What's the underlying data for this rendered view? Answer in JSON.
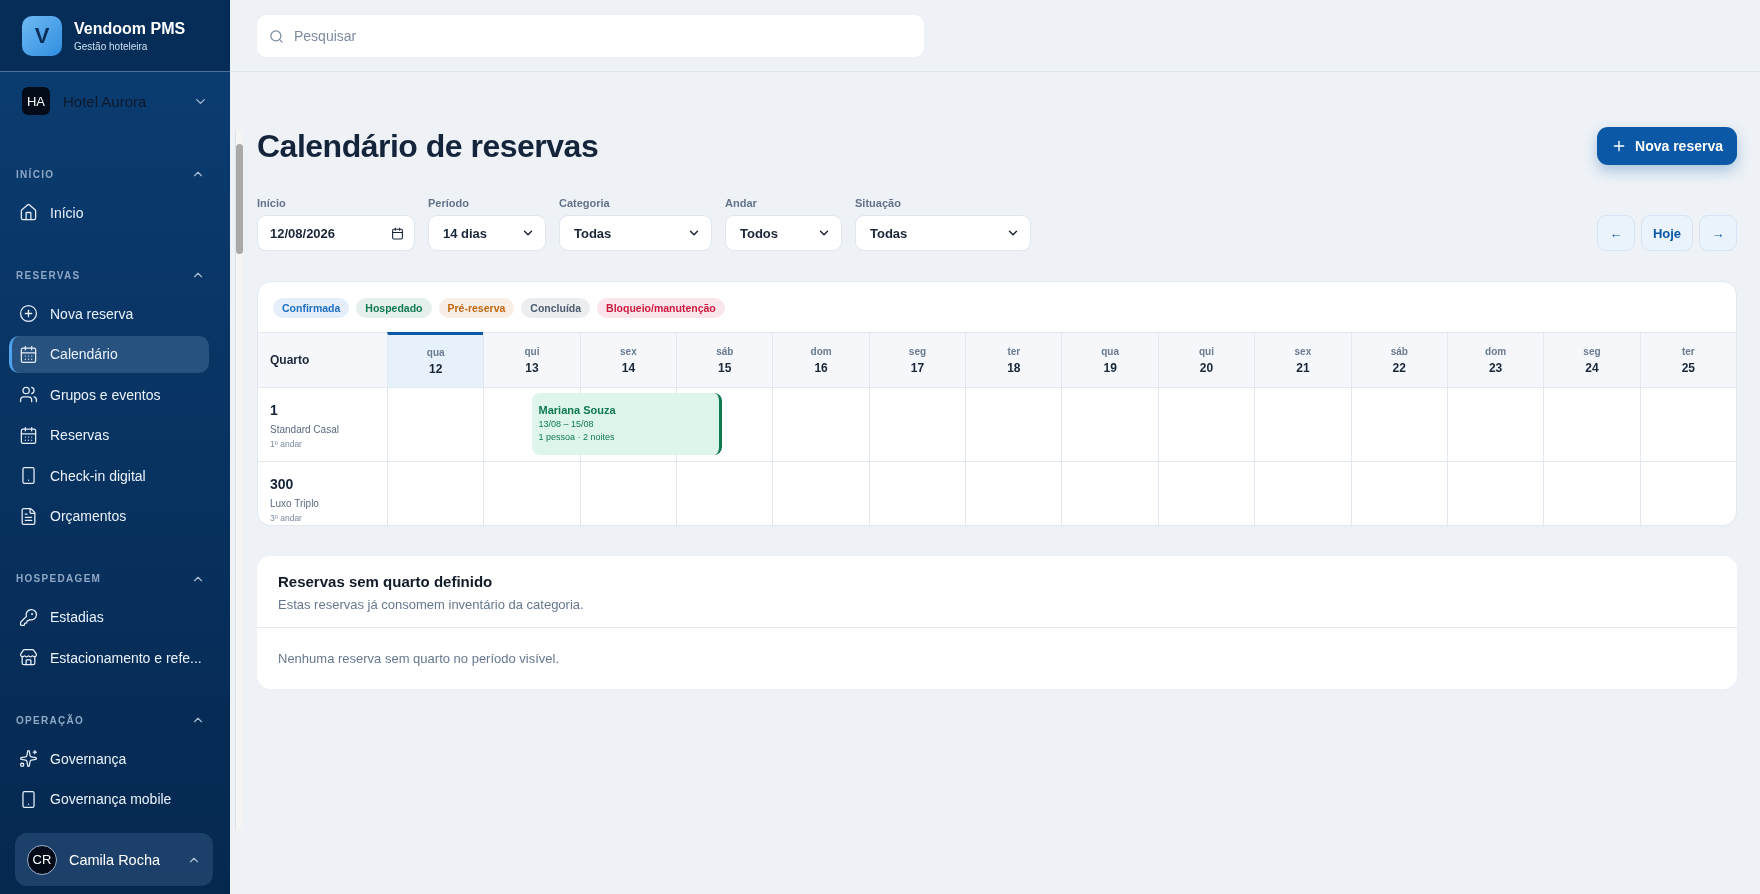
{
  "brand": {
    "logo_letter": "V",
    "name": "Vendoom PMS",
    "subtitle": "Gestão hoteleira"
  },
  "hotel": {
    "initials": "HA",
    "name": "Hotel Aurora"
  },
  "sidebar": {
    "sections": [
      {
        "title": "INÍCIO",
        "expanded": true,
        "items": [
          {
            "label": "Início",
            "selected": false
          }
        ]
      },
      {
        "title": "RESERVAS",
        "expanded": true,
        "items": [
          {
            "label": "Nova reserva",
            "selected": false
          },
          {
            "label": "Calendário",
            "selected": true
          },
          {
            "label": "Grupos e eventos",
            "selected": false
          },
          {
            "label": "Reservas",
            "selected": false
          },
          {
            "label": "Check-in digital",
            "selected": false
          },
          {
            "label": "Orçamentos",
            "selected": false
          }
        ]
      },
      {
        "title": "HOSPEDAGEM",
        "expanded": true,
        "items": [
          {
            "label": "Estadias",
            "selected": false
          },
          {
            "label": "Estacionamento e refe...",
            "selected": false
          }
        ]
      },
      {
        "title": "OPERAÇÃO",
        "expanded": true,
        "items": [
          {
            "label": "Governança",
            "selected": false
          },
          {
            "label": "Governança mobile",
            "selected": false
          }
        ]
      }
    ]
  },
  "user": {
    "initials": "CR",
    "name": "Camila Rocha"
  },
  "search": {
    "placeholder": "Pesquisar"
  },
  "page_title": "Calendário de reservas",
  "new_button": "Nova reserva",
  "filters": [
    {
      "kind": "date",
      "label": "Início",
      "value": "12/08/2026"
    },
    {
      "kind": "select",
      "label": "Período",
      "value": "14 dias"
    },
    {
      "kind": "select",
      "label": "Categoria",
      "value": "Todas"
    },
    {
      "kind": "select",
      "label": "Andar",
      "value": "Todos"
    },
    {
      "kind": "select",
      "label": "Situação",
      "value": "Todas"
    }
  ],
  "nav_buttons": [
    "←",
    "Hoje",
    "→"
  ],
  "legend": [
    {
      "label": "Confirmada",
      "color": "#1d6fc4"
    },
    {
      "label": "Hospedado",
      "color": "#0f7a4f"
    },
    {
      "label": "Pré-reserva",
      "color": "#c2660f"
    },
    {
      "label": "Concluída",
      "color": "#4b5a6e"
    },
    {
      "label": "Bloqueio/manutenção",
      "color": "#d0183f"
    }
  ],
  "calendar": {
    "room_header": "Quarto",
    "days": [
      {
        "weekday": "qua",
        "day": "12",
        "selected": true
      },
      {
        "weekday": "qui",
        "day": "13",
        "selected": false
      },
      {
        "weekday": "sex",
        "day": "14",
        "selected": false
      },
      {
        "weekday": "sáb",
        "day": "15",
        "selected": false
      },
      {
        "weekday": "dom",
        "day": "16",
        "selected": false
      },
      {
        "weekday": "seg",
        "day": "17",
        "selected": false
      },
      {
        "weekday": "ter",
        "day": "18",
        "selected": false
      },
      {
        "weekday": "qua",
        "day": "19",
        "selected": false
      },
      {
        "weekday": "qui",
        "day": "20",
        "selected": false
      },
      {
        "weekday": "sex",
        "day": "21",
        "selected": false
      },
      {
        "weekday": "sáb",
        "day": "22",
        "selected": false
      },
      {
        "weekday": "dom",
        "day": "23",
        "selected": false
      },
      {
        "weekday": "seg",
        "day": "24",
        "selected": false
      },
      {
        "weekday": "ter",
        "day": "25",
        "selected": false
      }
    ],
    "rooms": [
      {
        "number": "1",
        "category": "Standard Casal",
        "floor": "1º andar",
        "bookings": [
          {
            "guest": "Mariana Souza",
            "dates": "13/08 – 15/08",
            "details": "1 pessoa · 2 noites",
            "color": "#0f7a4f"
          }
        ]
      },
      {
        "number": "300",
        "category": "Luxo Triplo",
        "floor": "3º andar"
      }
    ]
  },
  "unassigned": {
    "title": "Reservas sem quarto definido",
    "subtitle": "Estas reservas já consomem inventário da categoria.",
    "empty": "Nenhuma reserva sem quarto no período visível."
  }
}
